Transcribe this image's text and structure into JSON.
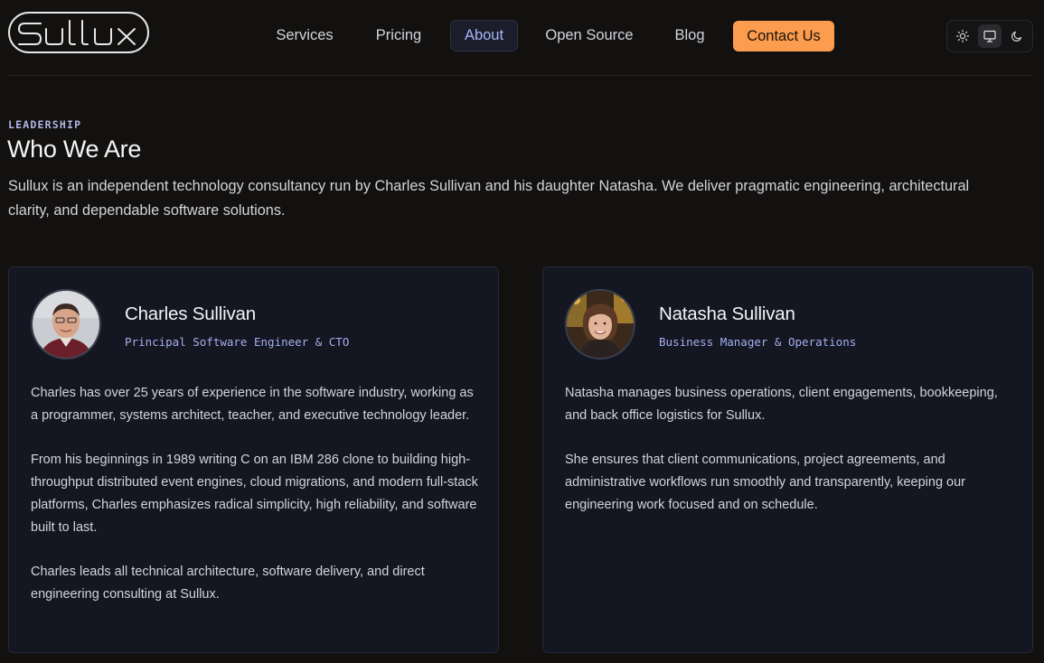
{
  "brand": {
    "logo_text": "Sullux"
  },
  "nav": {
    "items": [
      {
        "label": "Services"
      },
      {
        "label": "Pricing"
      },
      {
        "label": "About"
      },
      {
        "label": "Open Source"
      },
      {
        "label": "Blog"
      }
    ],
    "active": "About",
    "cta_label": "Contact Us"
  },
  "theme_toggle": {
    "options": [
      "sun-icon",
      "monitor-icon",
      "moon-icon"
    ],
    "selected": "monitor-icon"
  },
  "colors": {
    "background": "#121110",
    "card": "#141621",
    "accent": "#a5b4fc",
    "cta": "#fb9c4f"
  },
  "section": {
    "eyebrow": "LEADERSHIP",
    "title": "Who We Are",
    "intro": "Sullux is an independent technology consultancy run by Charles Sullivan and his daughter Natasha. We deliver pragmatic engineering, architectural clarity, and dependable software solutions."
  },
  "team": [
    {
      "name": "Charles Sullivan",
      "role": "Principal Software Engineer & CTO",
      "bio": [
        "Charles has over 25 years of experience in the software industry, working as a programmer, systems architect, teacher, and executive technology leader.",
        "From his beginnings in 1989 writing C on an IBM 286 clone to building high-throughput distributed event engines, cloud migrations, and modern full-stack platforms, Charles emphasizes radical simplicity, high reliability, and software built to last.",
        "Charles leads all technical architecture, software delivery, and direct engineering consulting at Sullux."
      ]
    },
    {
      "name": "Natasha Sullivan",
      "role": "Business Manager & Operations",
      "bio": [
        "Natasha manages business operations, client engagements, bookkeeping, and back office logistics for Sullux.",
        "She ensures that client communications, project agreements, and administrative workflows run smoothly and transparently, keeping our engineering work focused and on schedule."
      ]
    }
  ]
}
